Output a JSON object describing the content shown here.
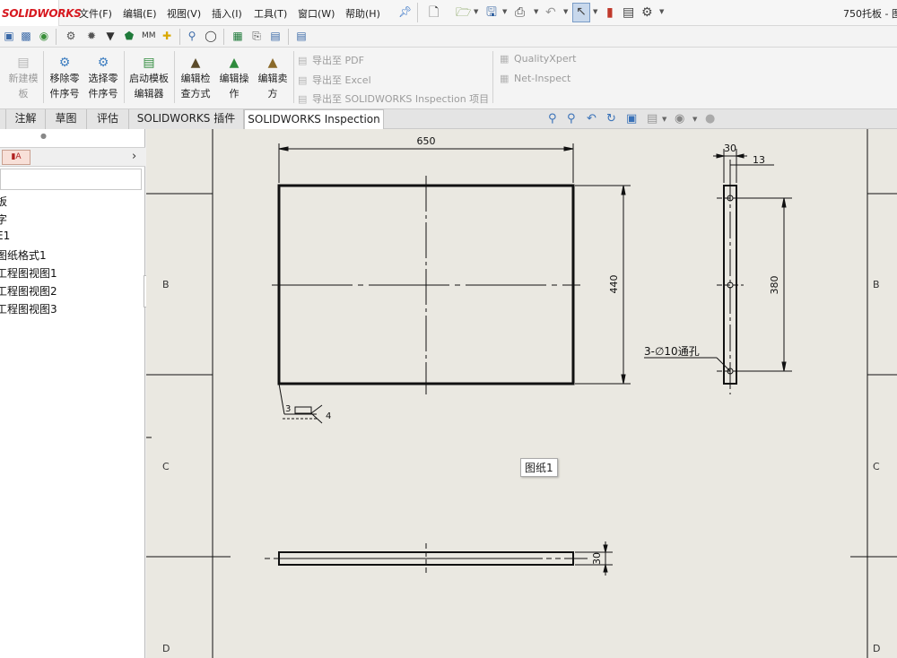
{
  "app": {
    "logo_text": "SOLIDWORKS",
    "brand_color": "#d71920",
    "document_title": "750托板 - 图"
  },
  "menu": [
    {
      "label": "文件(F)"
    },
    {
      "label": "编辑(E)"
    },
    {
      "label": "视图(V)"
    },
    {
      "label": "插入(I)"
    },
    {
      "label": "工具(T)"
    },
    {
      "label": "窗口(W)"
    },
    {
      "label": "帮助(H)"
    }
  ],
  "quick_access": [
    "new-icon",
    "open-icon",
    "save-icon",
    "print-icon",
    "undo-icon",
    "select-icon",
    "rebuild-icon",
    "file-properties-icon",
    "options-icon"
  ],
  "ribbon": {
    "buttons": [
      {
        "line1": "新建模",
        "line2": "板",
        "disabled": true
      },
      {
        "line1": "移除零",
        "line2": "件序号",
        "disabled": false
      },
      {
        "line1": "选择零",
        "line2": "件序号",
        "disabled": false
      },
      {
        "line1": "启动模板",
        "line2": "编辑器",
        "disabled": false
      },
      {
        "line1": "编辑检",
        "line2": "查方式",
        "disabled": false
      },
      {
        "line1": "编辑操",
        "line2": "作",
        "disabled": false
      },
      {
        "line1": "编辑卖",
        "line2": "方",
        "disabled": false
      }
    ],
    "export": [
      {
        "label": "导出至 PDF"
      },
      {
        "label": "导出至 Excel"
      },
      {
        "label": "导出至 SOLIDWORKS Inspection 项目"
      }
    ],
    "addins": [
      {
        "label": "QualityXpert"
      },
      {
        "label": "Net-Inspect"
      }
    ]
  },
  "tabs": [
    {
      "label": "注解",
      "active": false
    },
    {
      "label": "草图",
      "active": false
    },
    {
      "label": "评估",
      "active": false
    },
    {
      "label": "SOLIDWORKS 插件",
      "active": false
    },
    {
      "label": "SOLIDWORKS Inspection",
      "active": true
    }
  ],
  "feature_tree": {
    "items": [
      {
        "label": "板"
      },
      {
        "label": "字"
      },
      {
        "label": "E1"
      },
      {
        "label": "图纸格式1"
      },
      {
        "label": "工程图视图1"
      },
      {
        "label": "工程图视图2"
      },
      {
        "label": "工程图视图3"
      }
    ]
  },
  "sheet": {
    "tooltip": "图纸1",
    "zones": [
      "B",
      "C",
      "D"
    ],
    "dimensions": {
      "width": "650",
      "height": "440",
      "thickness": "30",
      "offset": "13",
      "hole_spacing": "380",
      "side_thickness": "30"
    },
    "hole_note": "3-∅10通孔",
    "weld_size": "3",
    "weld_length": "4"
  }
}
